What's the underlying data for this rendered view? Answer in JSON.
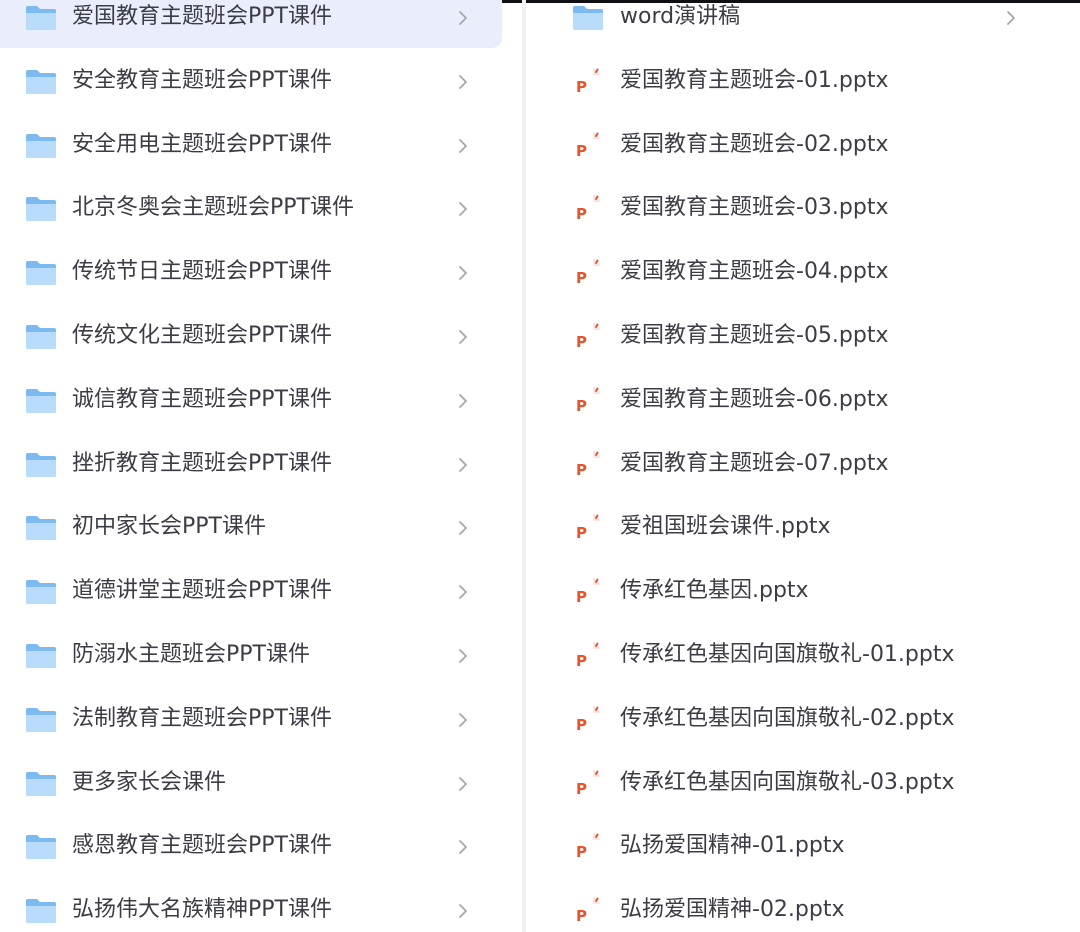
{
  "left_pane": {
    "items": [
      {
        "label": "爱国教育主题班会PPT课件",
        "icon": "folder-icon",
        "selected": true
      },
      {
        "label": "安全教育主题班会PPT课件",
        "icon": "folder-icon"
      },
      {
        "label": "安全用电主题班会PPT课件",
        "icon": "folder-icon"
      },
      {
        "label": "北京冬奥会主题班会PPT课件",
        "icon": "folder-icon"
      },
      {
        "label": "传统节日主题班会PPT课件",
        "icon": "folder-icon"
      },
      {
        "label": "传统文化主题班会PPT课件",
        "icon": "folder-icon"
      },
      {
        "label": "诚信教育主题班会PPT课件",
        "icon": "folder-icon"
      },
      {
        "label": "挫折教育主题班会PPT课件",
        "icon": "folder-icon"
      },
      {
        "label": "初中家长会PPT课件",
        "icon": "folder-icon"
      },
      {
        "label": "道德讲堂主题班会PPT课件",
        "icon": "folder-icon"
      },
      {
        "label": "防溺水主题班会PPT课件",
        "icon": "folder-icon"
      },
      {
        "label": "法制教育主题班会PPT课件",
        "icon": "folder-icon"
      },
      {
        "label": "更多家长会课件",
        "icon": "folder-icon"
      },
      {
        "label": "感恩教育主题班会PPT课件",
        "icon": "folder-icon"
      },
      {
        "label": "弘扬伟大名族精神PPT课件",
        "icon": "folder-icon"
      }
    ]
  },
  "right_pane": {
    "items": [
      {
        "label": "word演讲稿",
        "icon": "folder-icon",
        "has_chevron": true
      },
      {
        "label": "爱国教育主题班会-01.pptx",
        "icon": "ppt-file-icon"
      },
      {
        "label": "爱国教育主题班会-02.pptx",
        "icon": "ppt-file-icon"
      },
      {
        "label": "爱国教育主题班会-03.pptx",
        "icon": "ppt-file-icon"
      },
      {
        "label": "爱国教育主题班会-04.pptx",
        "icon": "ppt-file-icon"
      },
      {
        "label": "爱国教育主题班会-05.pptx",
        "icon": "ppt-file-icon"
      },
      {
        "label": "爱国教育主题班会-06.pptx",
        "icon": "ppt-file-icon"
      },
      {
        "label": "爱国教育主题班会-07.pptx",
        "icon": "ppt-file-icon"
      },
      {
        "label": "爱祖国班会课件.pptx",
        "icon": "ppt-file-icon"
      },
      {
        "label": "传承红色基因.pptx",
        "icon": "ppt-file-icon"
      },
      {
        "label": "传承红色基因向国旗敬礼-01.pptx",
        "icon": "ppt-file-icon"
      },
      {
        "label": "传承红色基因向国旗敬礼-02.pptx",
        "icon": "ppt-file-icon"
      },
      {
        "label": "传承红色基因向国旗敬礼-03.pptx",
        "icon": "ppt-file-icon"
      },
      {
        "label": "弘扬爱国精神-01.pptx",
        "icon": "ppt-file-icon"
      },
      {
        "label": "弘扬爱国精神-02.pptx",
        "icon": "ppt-file-icon"
      }
    ]
  },
  "colors": {
    "folder_light": "#b9dcfa",
    "folder_dark": "#7cbaf0",
    "ppt_orange": "#e8532b",
    "selected_bg": "#eaeefc",
    "chevron": "#a6a6ae",
    "text": "#3c3c46"
  }
}
